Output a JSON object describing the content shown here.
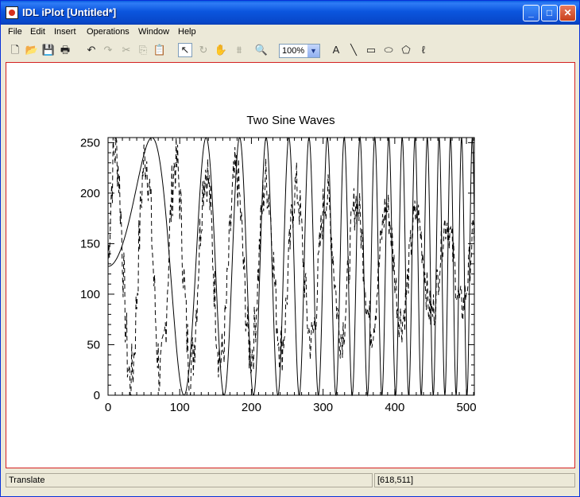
{
  "window": {
    "title": "IDL iPlot [Untitled*]",
    "controls": {
      "minimize": "_",
      "maximize": "□",
      "close": "✕"
    }
  },
  "menubar": {
    "items": [
      {
        "label": "File"
      },
      {
        "label": "Edit"
      },
      {
        "label": "Insert"
      },
      {
        "label": "Operations"
      },
      {
        "label": "Window"
      },
      {
        "label": "Help"
      }
    ]
  },
  "toolbar": {
    "tools": [
      {
        "name": "new-file-icon",
        "glyph": "🗋",
        "enabled": true
      },
      {
        "name": "open-folder-icon",
        "glyph": "📂",
        "enabled": true
      },
      {
        "name": "save-icon",
        "glyph": "💾",
        "enabled": true
      },
      {
        "name": "print-icon",
        "glyph": "🖶",
        "enabled": true
      },
      {
        "name": "undo-icon",
        "glyph": "↶",
        "enabled": true
      },
      {
        "name": "redo-icon",
        "glyph": "↷",
        "enabled": false
      },
      {
        "name": "cut-icon",
        "glyph": "✂",
        "enabled": false
      },
      {
        "name": "copy-icon",
        "glyph": "⎘",
        "enabled": false
      },
      {
        "name": "paste-icon",
        "glyph": "📋",
        "enabled": true
      },
      {
        "name": "select-arrow-icon",
        "glyph": "↖",
        "enabled": true,
        "active": true
      },
      {
        "name": "rotate-icon",
        "glyph": "↻",
        "enabled": false
      },
      {
        "name": "pan-hand-icon",
        "glyph": "✋",
        "enabled": false
      },
      {
        "name": "data-range-icon",
        "glyph": "⩩",
        "enabled": false
      },
      {
        "name": "zoom-magnifier-icon",
        "glyph": "🔍",
        "enabled": true
      },
      {
        "name": "text-tool-icon",
        "glyph": "A",
        "enabled": true
      },
      {
        "name": "line-tool-icon",
        "glyph": "╲",
        "enabled": true
      },
      {
        "name": "rectangle-tool-icon",
        "glyph": "▭",
        "enabled": true
      },
      {
        "name": "ellipse-tool-icon",
        "glyph": "⬭",
        "enabled": true
      },
      {
        "name": "polygon-tool-icon",
        "glyph": "⬠",
        "enabled": true
      },
      {
        "name": "freehand-tool-icon",
        "glyph": "ℓ",
        "enabled": true
      }
    ],
    "zoom": {
      "value": "100%",
      "arrow": "▼"
    }
  },
  "chart_data": {
    "type": "line",
    "title": "Two Sine Waves",
    "xlabel": "",
    "ylabel": "",
    "xlim": [
      0,
      511
    ],
    "ylim": [
      0,
      255
    ],
    "xticks": [
      0,
      100,
      200,
      300,
      400,
      500
    ],
    "yticks": [
      0,
      50,
      100,
      150,
      200,
      250
    ],
    "grid": false,
    "series": [
      {
        "style": "solid",
        "description_of_values": "chirp sine scaled 0-255",
        "values_rule": {
          "amplitude": 127.5,
          "offset": 127.5,
          "phase_quadratic_coefficient": 6.68e-05,
          "x_range": [
            0,
            511
          ]
        }
      },
      {
        "style": "dashed",
        "description_of_values": "noisy decaying sine scaled 0-255",
        "values_rule": {
          "period": 42,
          "amplitude_start": 118,
          "amplitude_end": 38,
          "offset": 128,
          "x_range": [
            0,
            511
          ]
        }
      }
    ]
  },
  "statusbar": {
    "message": "Translate",
    "coords": "[618,511]"
  }
}
